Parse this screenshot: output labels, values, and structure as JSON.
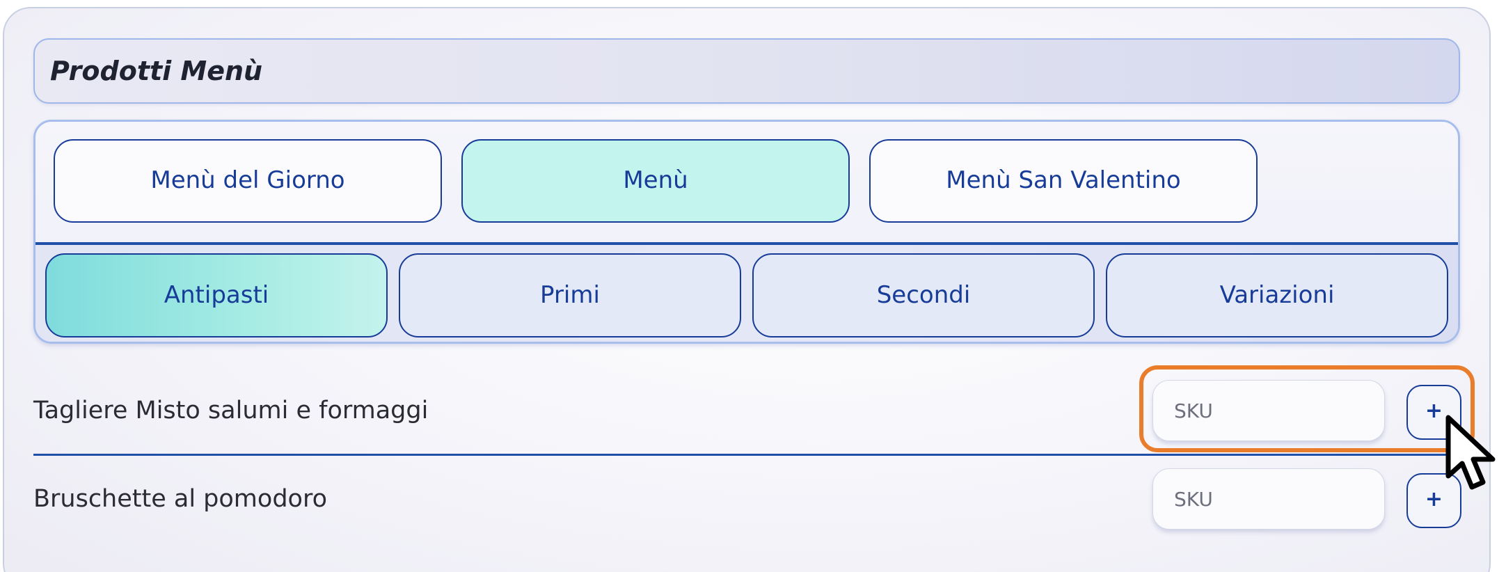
{
  "section": {
    "title": "Prodotti Menù"
  },
  "menu_tabs": [
    {
      "label": "Menù del Giorno",
      "active": false
    },
    {
      "label": "Menù",
      "active": true
    },
    {
      "label": "Menù San Valentino",
      "active": false
    }
  ],
  "category_tabs": [
    {
      "label": "Antipasti",
      "active": true
    },
    {
      "label": "Primi",
      "active": false
    },
    {
      "label": "Secondi",
      "active": false
    },
    {
      "label": "Variazioni",
      "active": false
    }
  ],
  "products": [
    {
      "name": "Tagliere Misto salumi e formaggi",
      "sku_placeholder": "SKU",
      "sku_value": "",
      "add_label": "+"
    },
    {
      "name": "Bruschette al pomodoro",
      "sku_placeholder": "SKU",
      "sku_value": "",
      "add_label": "+"
    }
  ],
  "colors": {
    "accent": "#173c98",
    "active_tab": "#c3f4ee",
    "highlight": "#ea7d2c"
  },
  "icons": {
    "cursor": "mouse-pointer-icon",
    "add": "plus-icon"
  }
}
